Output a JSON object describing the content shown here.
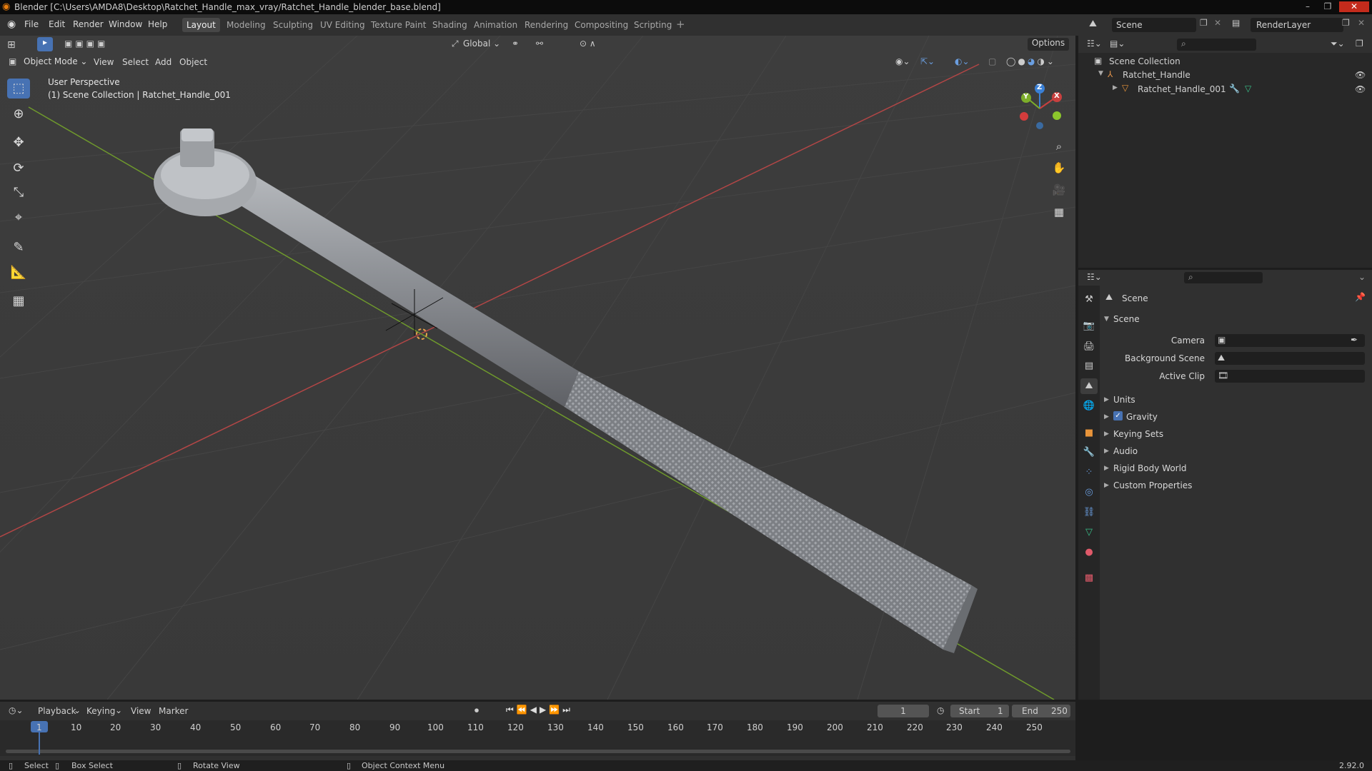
{
  "window": {
    "title": "Blender [C:\\Users\\AMDA8\\Desktop\\Ratchet_Handle_max_vray/Ratchet_Handle_blender_base.blend]",
    "controls": [
      "–",
      "❐",
      "✕"
    ]
  },
  "menu": [
    "File",
    "Edit",
    "Render",
    "Window",
    "Help"
  ],
  "workspaces": {
    "active": "Layout",
    "tabs": [
      "Layout",
      "Modeling",
      "Sculpting",
      "UV Editing",
      "Texture Paint",
      "Shading",
      "Animation",
      "Rendering",
      "Compositing",
      "Scripting"
    ],
    "add": "+"
  },
  "topbar": {
    "scene": "Scene",
    "view_layer": "RenderLayer"
  },
  "viewport": {
    "transform_orientation": "Global",
    "options": "Options",
    "mode": "Object Mode",
    "menus": [
      "View",
      "Select",
      "Add",
      "Object"
    ],
    "overlay_title": "User Perspective",
    "overlay_sub": "(1) Scene Collection | Ratchet_Handle_001",
    "gizmo": {
      "x": "X",
      "y": "Y",
      "z": "Z"
    }
  },
  "outliner": {
    "root": "Scene Collection",
    "items": [
      {
        "label": "Ratchet_Handle",
        "level": 1
      },
      {
        "label": "Ratchet_Handle_001",
        "level": 2
      }
    ]
  },
  "properties": {
    "header": "Scene",
    "section": "Scene",
    "fields": [
      {
        "label": "Camera"
      },
      {
        "label": "Background Scene"
      },
      {
        "label": "Active Clip"
      }
    ],
    "panels": [
      "Units",
      "Gravity",
      "Keying Sets",
      "Audio",
      "Rigid Body World",
      "Custom Properties"
    ],
    "gravity_checked": true
  },
  "timeline": {
    "menus": [
      "Playback",
      "Keying",
      "View",
      "Marker"
    ],
    "current_frame": "1",
    "start_label": "Start",
    "start": "1",
    "end_label": "End",
    "end": "250",
    "ruler": [
      "1",
      "10",
      "20",
      "30",
      "40",
      "50",
      "60",
      "70",
      "80",
      "90",
      "100",
      "110",
      "120",
      "130",
      "140",
      "150",
      "160",
      "170",
      "180",
      "190",
      "200",
      "210",
      "220",
      "230",
      "240",
      "250"
    ]
  },
  "status": {
    "select": "Select",
    "box_select": "Box Select",
    "rotate_view": "Rotate View",
    "context_menu": "Object Context Menu",
    "version": "2.92.0"
  },
  "colors": {
    "accent": "#4772b3",
    "x_axis": "#c9403f",
    "y_axis": "#7dae2a",
    "z_axis": "#3a80d6"
  }
}
